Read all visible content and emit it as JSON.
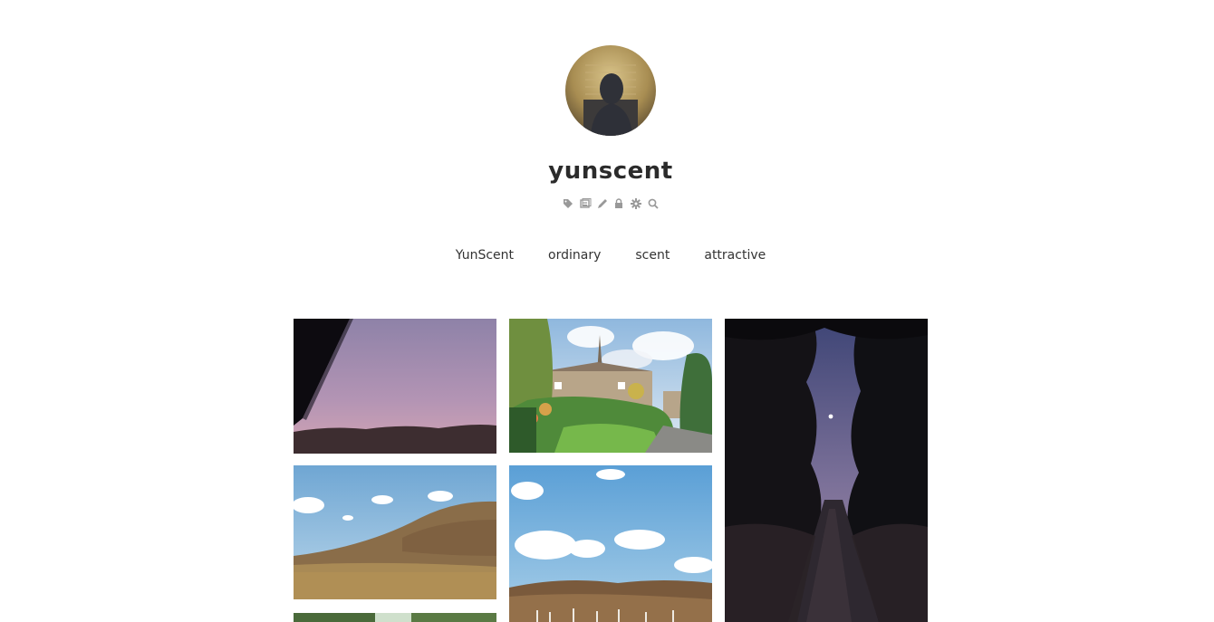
{
  "blog": {
    "title": "yunscent"
  },
  "admin_icons": [
    "tag-icon",
    "archive-icon",
    "write-icon",
    "lock-icon",
    "settings-icon",
    "search-icon"
  ],
  "nav": {
    "items": [
      "YunScent",
      "ordinary",
      "scent",
      "attractive"
    ]
  },
  "colors": {
    "text": "#333333",
    "icon": "#999999",
    "background": "#ffffff"
  }
}
